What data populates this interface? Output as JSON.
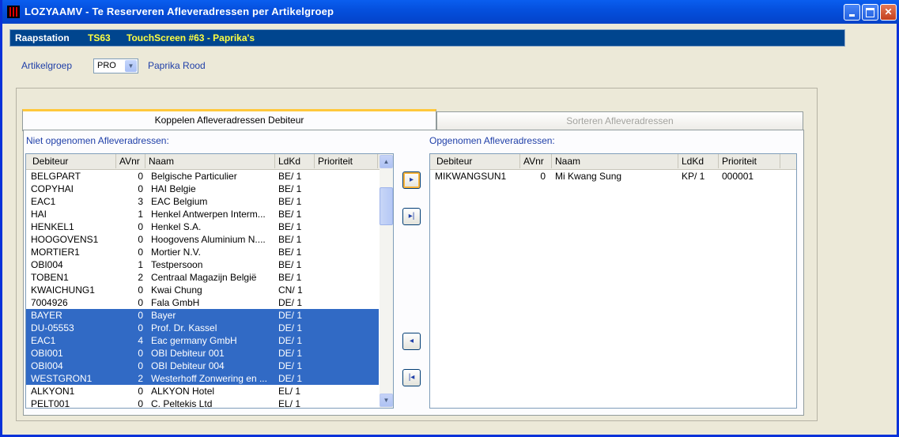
{
  "window": {
    "title": "LOZYAAMV - Te Reserveren Afleveradressen per Artikelgroep",
    "controls": [
      "minimize-icon",
      "maximize-icon",
      "close-icon"
    ]
  },
  "infobar": {
    "label": "Raapstation",
    "station_code": "TS63",
    "station_name": "TouchScreen #63 - Paprika's"
  },
  "artikelgroep": {
    "label": "Artikelgroep",
    "value": "PRO",
    "name": "Paprika Rood"
  },
  "tabs": [
    {
      "label": "Koppelen Afleveradressen Debiteur",
      "active": true
    },
    {
      "label": "Sorteren Afleveradressen",
      "active": false
    }
  ],
  "left": {
    "title": "Niet opgenomen Afleveradressen:",
    "columns": [
      "Debiteur",
      "AVnr",
      "Naam",
      "LdKd",
      "Prioriteit"
    ],
    "rows": [
      {
        "debiteur": "BELGPART",
        "avnr": "0",
        "naam": "Belgische Particulier",
        "ldkd": "BE/ 1",
        "prio": "",
        "selected": false
      },
      {
        "debiteur": "COPYHAI",
        "avnr": "0",
        "naam": "HAI Belgie",
        "ldkd": "BE/ 1",
        "prio": "",
        "selected": false
      },
      {
        "debiteur": "EAC1",
        "avnr": "3",
        "naam": "EAC Belgium",
        "ldkd": "BE/ 1",
        "prio": "",
        "selected": false
      },
      {
        "debiteur": "HAI",
        "avnr": "1",
        "naam": "Henkel Antwerpen Interm...",
        "ldkd": "BE/ 1",
        "prio": "",
        "selected": false
      },
      {
        "debiteur": "HENKEL1",
        "avnr": "0",
        "naam": "Henkel S.A.",
        "ldkd": "BE/ 1",
        "prio": "",
        "selected": false
      },
      {
        "debiteur": "HOOGOVENS1",
        "avnr": "0",
        "naam": "Hoogovens Aluminium N....",
        "ldkd": "BE/ 1",
        "prio": "",
        "selected": false
      },
      {
        "debiteur": "MORTIER1",
        "avnr": "0",
        "naam": "Mortier N.V.",
        "ldkd": "BE/ 1",
        "prio": "",
        "selected": false
      },
      {
        "debiteur": "OBI004",
        "avnr": "1",
        "naam": "Testpersoon",
        "ldkd": "BE/ 1",
        "prio": "",
        "selected": false
      },
      {
        "debiteur": "TOBEN1",
        "avnr": "2",
        "naam": "Centraal Magazijn België",
        "ldkd": "BE/ 1",
        "prio": "",
        "selected": false
      },
      {
        "debiteur": "KWAICHUNG1",
        "avnr": "0",
        "naam": "Kwai Chung",
        "ldkd": "CN/ 1",
        "prio": "",
        "selected": false
      },
      {
        "debiteur": "7004926",
        "avnr": "0",
        "naam": "Fala GmbH",
        "ldkd": "DE/ 1",
        "prio": "",
        "selected": false
      },
      {
        "debiteur": "BAYER",
        "avnr": "0",
        "naam": "Bayer",
        "ldkd": "DE/ 1",
        "prio": "",
        "selected": true
      },
      {
        "debiteur": "DU-05553",
        "avnr": "0",
        "naam": "Prof. Dr. Kassel",
        "ldkd": "DE/ 1",
        "prio": "",
        "selected": true
      },
      {
        "debiteur": "EAC1",
        "avnr": "4",
        "naam": "Eac germany GmbH",
        "ldkd": "DE/ 1",
        "prio": "",
        "selected": true
      },
      {
        "debiteur": "OBI001",
        "avnr": "0",
        "naam": "OBI Debiteur 001",
        "ldkd": "DE/ 1",
        "prio": "",
        "selected": true
      },
      {
        "debiteur": "OBI004",
        "avnr": "0",
        "naam": "OBI Debiteur 004",
        "ldkd": "DE/ 1",
        "prio": "",
        "selected": true
      },
      {
        "debiteur": "WESTGRON1",
        "avnr": "2",
        "naam": "Westerhoff Zonwering en ...",
        "ldkd": "DE/ 1",
        "prio": "",
        "selected": true
      },
      {
        "debiteur": "ALKYON1",
        "avnr": "0",
        "naam": "ALKYON Hotel",
        "ldkd": "EL/ 1",
        "prio": "",
        "selected": false
      },
      {
        "debiteur": "PELT001",
        "avnr": "0",
        "naam": "C. Peltekis Ltd",
        "ldkd": "EL/ 1",
        "prio": "",
        "selected": false
      }
    ]
  },
  "right": {
    "title": "Opgenomen Afleveradressen:",
    "columns": [
      "Debiteur",
      "AVnr",
      "Naam",
      "LdKd",
      "Prioriteit"
    ],
    "rows": [
      {
        "debiteur": "MIKWANGSUN1",
        "avnr": "0",
        "naam": "Mi Kwang Sung",
        "ldkd": "KP/ 1",
        "prio": "000001",
        "selected": false
      }
    ]
  },
  "move_buttons": [
    {
      "name": "move-right-button",
      "icon": "arrow-right-icon"
    },
    {
      "name": "move-all-right-button",
      "icon": "arrow-right-bar-icon"
    },
    {
      "name": "move-left-button",
      "icon": "arrow-left-icon"
    },
    {
      "name": "move-all-left-button",
      "icon": "arrow-left-bar-icon"
    }
  ],
  "colors": {
    "titlebar": "#0550DE",
    "infobar": "#00458E",
    "selection": "#316AC5",
    "accent_yellow": "#FFFF40",
    "label_blue": "#1F3FA8"
  }
}
